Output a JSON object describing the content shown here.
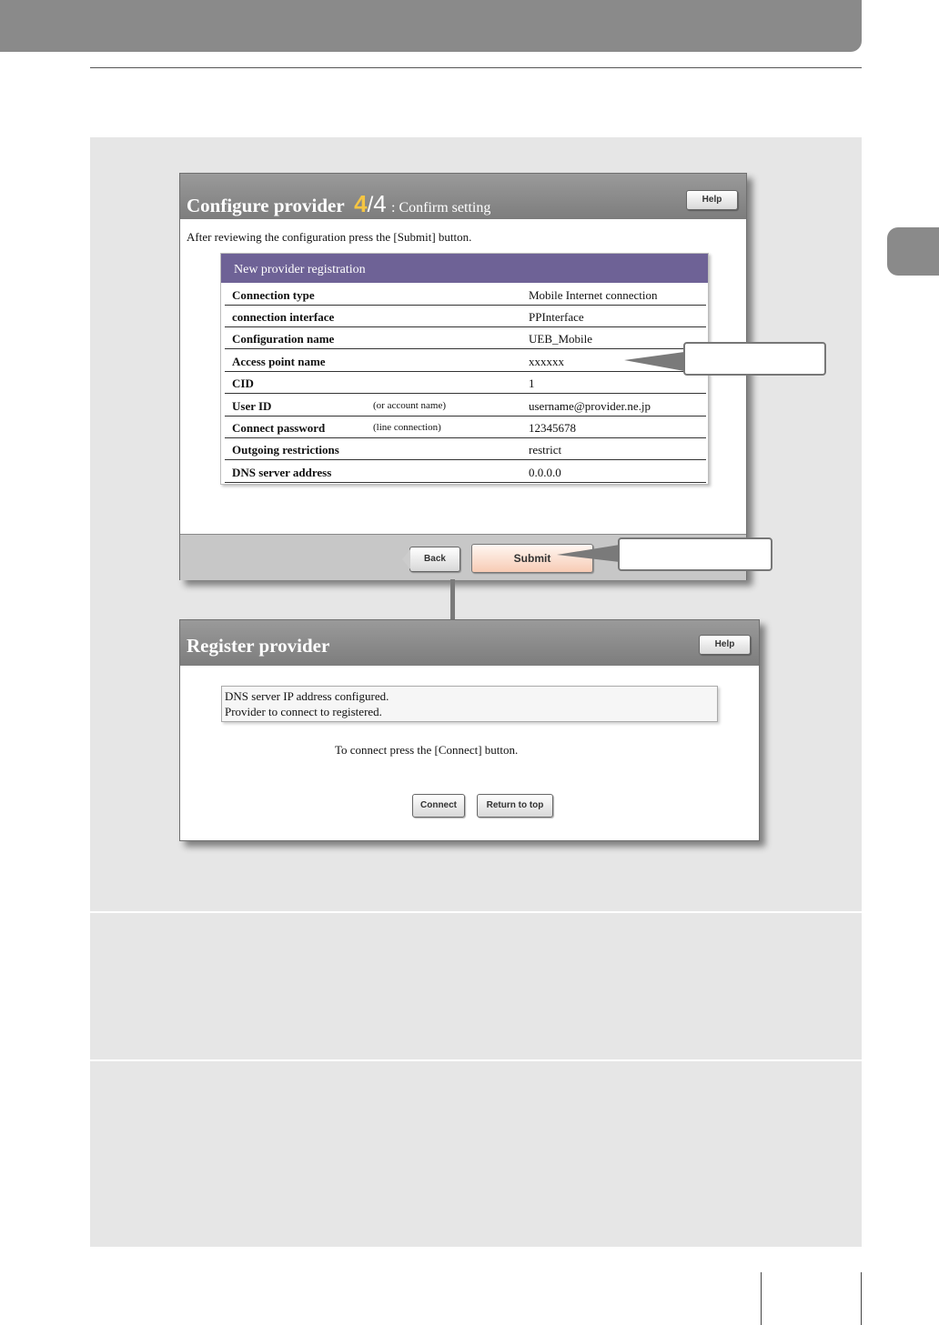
{
  "window1": {
    "title": "Configure provider",
    "step_current": "4",
    "step_separator": "/",
    "step_total": "4",
    "step_label": ": Confirm setting",
    "help_label": "Help",
    "intro_text": "After reviewing the configuration press the [Submit] button.",
    "table": {
      "header": "New provider registration",
      "rows": [
        {
          "label": "Connection type",
          "note": "",
          "value": "Mobile Internet connection"
        },
        {
          "label": "connection interface",
          "note": "",
          "value": "PPInterface"
        },
        {
          "label": "Configuration name",
          "note": "",
          "value": "UEB_Mobile"
        },
        {
          "label": "Access point name",
          "note": "",
          "value": "xxxxxx"
        },
        {
          "label": "CID",
          "note": "",
          "value": "1"
        },
        {
          "label": "User ID",
          "note": "(or account name)",
          "value": "username@provider.ne.jp"
        },
        {
          "label": "Connect password",
          "note": "(line connection)",
          "value": "12345678"
        },
        {
          "label": "Outgoing restrictions",
          "note": "",
          "value": "restrict"
        },
        {
          "label": "DNS server address",
          "note": "",
          "value": "0.0.0.0"
        }
      ]
    },
    "back_label": "Back",
    "submit_label": "Submit"
  },
  "window2": {
    "title": "Register provider",
    "help_label": "Help",
    "message_line1": "DNS server IP address configured.",
    "message_line2": "Provider to connect to registered.",
    "connect_text": "To connect press the [Connect] button.",
    "connect_label": "Connect",
    "return_label": "Return to top"
  },
  "colors": {
    "titlebar": "#8a8a8a",
    "step_accent": "#f5c542",
    "table_header": "#6e6296",
    "submit_button": "#f7cbb4",
    "panel_background": "#e6e6e6"
  }
}
